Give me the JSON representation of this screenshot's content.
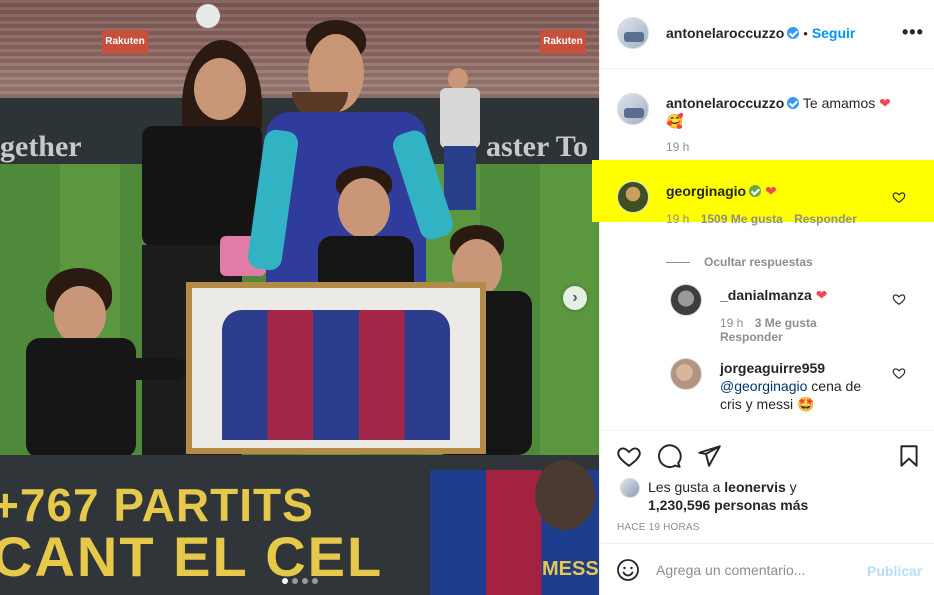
{
  "post": {
    "username": "antonelaroccuzzo",
    "separator": "•",
    "follow_label": "Seguir",
    "more_label": "•••"
  },
  "photo": {
    "board_text_left": "gether",
    "board_text_right": "aster To",
    "banner_line1": "+767 PARTITS",
    "banner_line2": "CANT EL CEL",
    "banner_name": "MESSI",
    "sign_label": "Rakuten",
    "next_label": "›",
    "carousel": {
      "count": 4,
      "active": 0
    }
  },
  "caption": {
    "username": "antonelaroccuzzo",
    "text": "Te amamos",
    "emoji_heart": "❤",
    "emoji_face": "🥰",
    "time": "19 h"
  },
  "comments": [
    {
      "username": "georginagio",
      "text": "❤",
      "time": "19 h",
      "likes": "1509 Me gusta",
      "reply": "Responder",
      "highlighted": true,
      "badge_color": "#6aa84f"
    }
  ],
  "hide_replies": "Ocultar respuestas",
  "replies": [
    {
      "username": "_danialmanza",
      "text": "❤",
      "time": "19 h",
      "likes": "3 Me gusta",
      "reply": "Responder"
    },
    {
      "username": "jorgeaguirre959",
      "mention": "@georginagio",
      "text": "cena de cris y messi",
      "emoji": "🤩"
    }
  ],
  "likes": {
    "prefix": "Les gusta a",
    "user": "leonervis",
    "conj": "y",
    "count": "1,230,596 personas más"
  },
  "timestamp": "HACE 19 HORAS",
  "add_comment": {
    "placeholder": "Agrega un comentario...",
    "publish": "Publicar"
  },
  "colors": {
    "link": "#0095f6",
    "verified": "#3897f0",
    "highlight": "#ffff00",
    "heart": "#ed4956",
    "publish_disabled": "#b2dffc"
  },
  "icons": [
    "heart-icon",
    "comment-icon",
    "share-icon",
    "save-icon",
    "emoji-icon",
    "more-icon",
    "verified-badge-icon"
  ]
}
